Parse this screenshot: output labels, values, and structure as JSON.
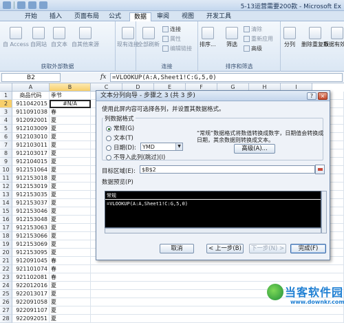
{
  "window": {
    "title": "5-13运营需要200款 - Microsoft Ex"
  },
  "ribbon": {
    "tabs": [
      "开始",
      "插入",
      "页面布局",
      "公式",
      "数据",
      "审阅",
      "视图",
      "开发工具"
    ],
    "active_tab": "数据",
    "get_external": {
      "label": "获取外部数据",
      "buttons": [
        "自 Access",
        "自网站",
        "自文本",
        "自其他来源",
        "现有连接"
      ]
    },
    "connections": {
      "label": "连接",
      "refresh_all": "全部刷新",
      "items": [
        "连接",
        "属性",
        "编辑链接"
      ]
    },
    "sort_filter": {
      "label": "排序和筛选",
      "sort": "排序...",
      "filter": "筛选",
      "items": [
        "清除",
        "重新应用",
        "高级"
      ]
    },
    "tools": {
      "split": "分列",
      "remove_dup": "删除重复项",
      "validation": "数据有效性"
    }
  },
  "formula_bar": {
    "name_box": "B2",
    "fx": "fx",
    "formula": "=VLOOKUP(A:A,Sheet1!C:G,5,0)"
  },
  "grid": {
    "columns": [
      "A",
      "B",
      "C",
      "D",
      "E",
      "F",
      "G",
      "H",
      "I"
    ],
    "rows": [
      {
        "n": "1",
        "a": "商品代码",
        "b": "季节"
      },
      {
        "n": "2",
        "a": "911042015",
        "b": "#N/A"
      },
      {
        "n": "3",
        "a": "911091038",
        "b": "春"
      },
      {
        "n": "4",
        "a": "912092001",
        "b": "夏"
      },
      {
        "n": "5",
        "a": "912103009",
        "b": "夏"
      },
      {
        "n": "6",
        "a": "912103010",
        "b": "夏"
      },
      {
        "n": "7",
        "a": "912103011",
        "b": "夏"
      },
      {
        "n": "8",
        "a": "912103017",
        "b": "夏"
      },
      {
        "n": "9",
        "a": "912104015",
        "b": "夏"
      },
      {
        "n": "10",
        "a": "912151064",
        "b": "夏"
      },
      {
        "n": "11",
        "a": "912153018",
        "b": "夏"
      },
      {
        "n": "12",
        "a": "912153019",
        "b": "夏"
      },
      {
        "n": "13",
        "a": "912153035",
        "b": "夏"
      },
      {
        "n": "14",
        "a": "912153037",
        "b": "夏"
      },
      {
        "n": "15",
        "a": "912153046",
        "b": "夏"
      },
      {
        "n": "16",
        "a": "912153048",
        "b": "夏"
      },
      {
        "n": "17",
        "a": "912153063",
        "b": "夏"
      },
      {
        "n": "18",
        "a": "912153066",
        "b": "夏"
      },
      {
        "n": "19",
        "a": "912153069",
        "b": "夏"
      },
      {
        "n": "20",
        "a": "912153095",
        "b": "夏"
      },
      {
        "n": "21",
        "a": "912091045",
        "b": "春"
      },
      {
        "n": "22",
        "a": "921101074",
        "b": "春"
      },
      {
        "n": "23",
        "a": "921102081",
        "b": "春"
      },
      {
        "n": "24",
        "a": "922012016",
        "b": "夏"
      },
      {
        "n": "25",
        "a": "922013017",
        "b": "夏"
      },
      {
        "n": "26",
        "a": "922091058",
        "b": "夏"
      },
      {
        "n": "27",
        "a": "922091107",
        "b": "夏"
      },
      {
        "n": "28",
        "a": "922092051",
        "b": "夏"
      }
    ]
  },
  "dialog": {
    "title": "文本分列向导 - 步骤之 3 (共 3 步)",
    "close": "×",
    "help": "?",
    "intro": "使用此屏内容可选择各列，并设置其数据格式。",
    "format_group": "列数据格式",
    "options": [
      "常规(G)",
      "文本(T)",
      "日期(D):",
      "不导入此列(跳过)(I)"
    ],
    "selected_option": 0,
    "date_format": "YMD",
    "note_line1": "“常规”数据格式将数值转换成数字，日期值会转换成",
    "note_line2": "日期，其余数据则转换成文本。",
    "advanced": "高级(A)...",
    "dest_label": "目标区域(E):",
    "dest_value": "$B$2",
    "preview_label": "数据预览(P)",
    "preview_header": "常规",
    "preview_line": "=VLOOKUP(A:A,Sheet1!C:G,5,0)",
    "buttons": {
      "cancel": "取消",
      "back": "< 上一步(B)",
      "next": "下一步(N) >",
      "finish": "完成(F)"
    }
  },
  "watermark": {
    "name": "当客软件园",
    "url": "www.downkr.com"
  }
}
